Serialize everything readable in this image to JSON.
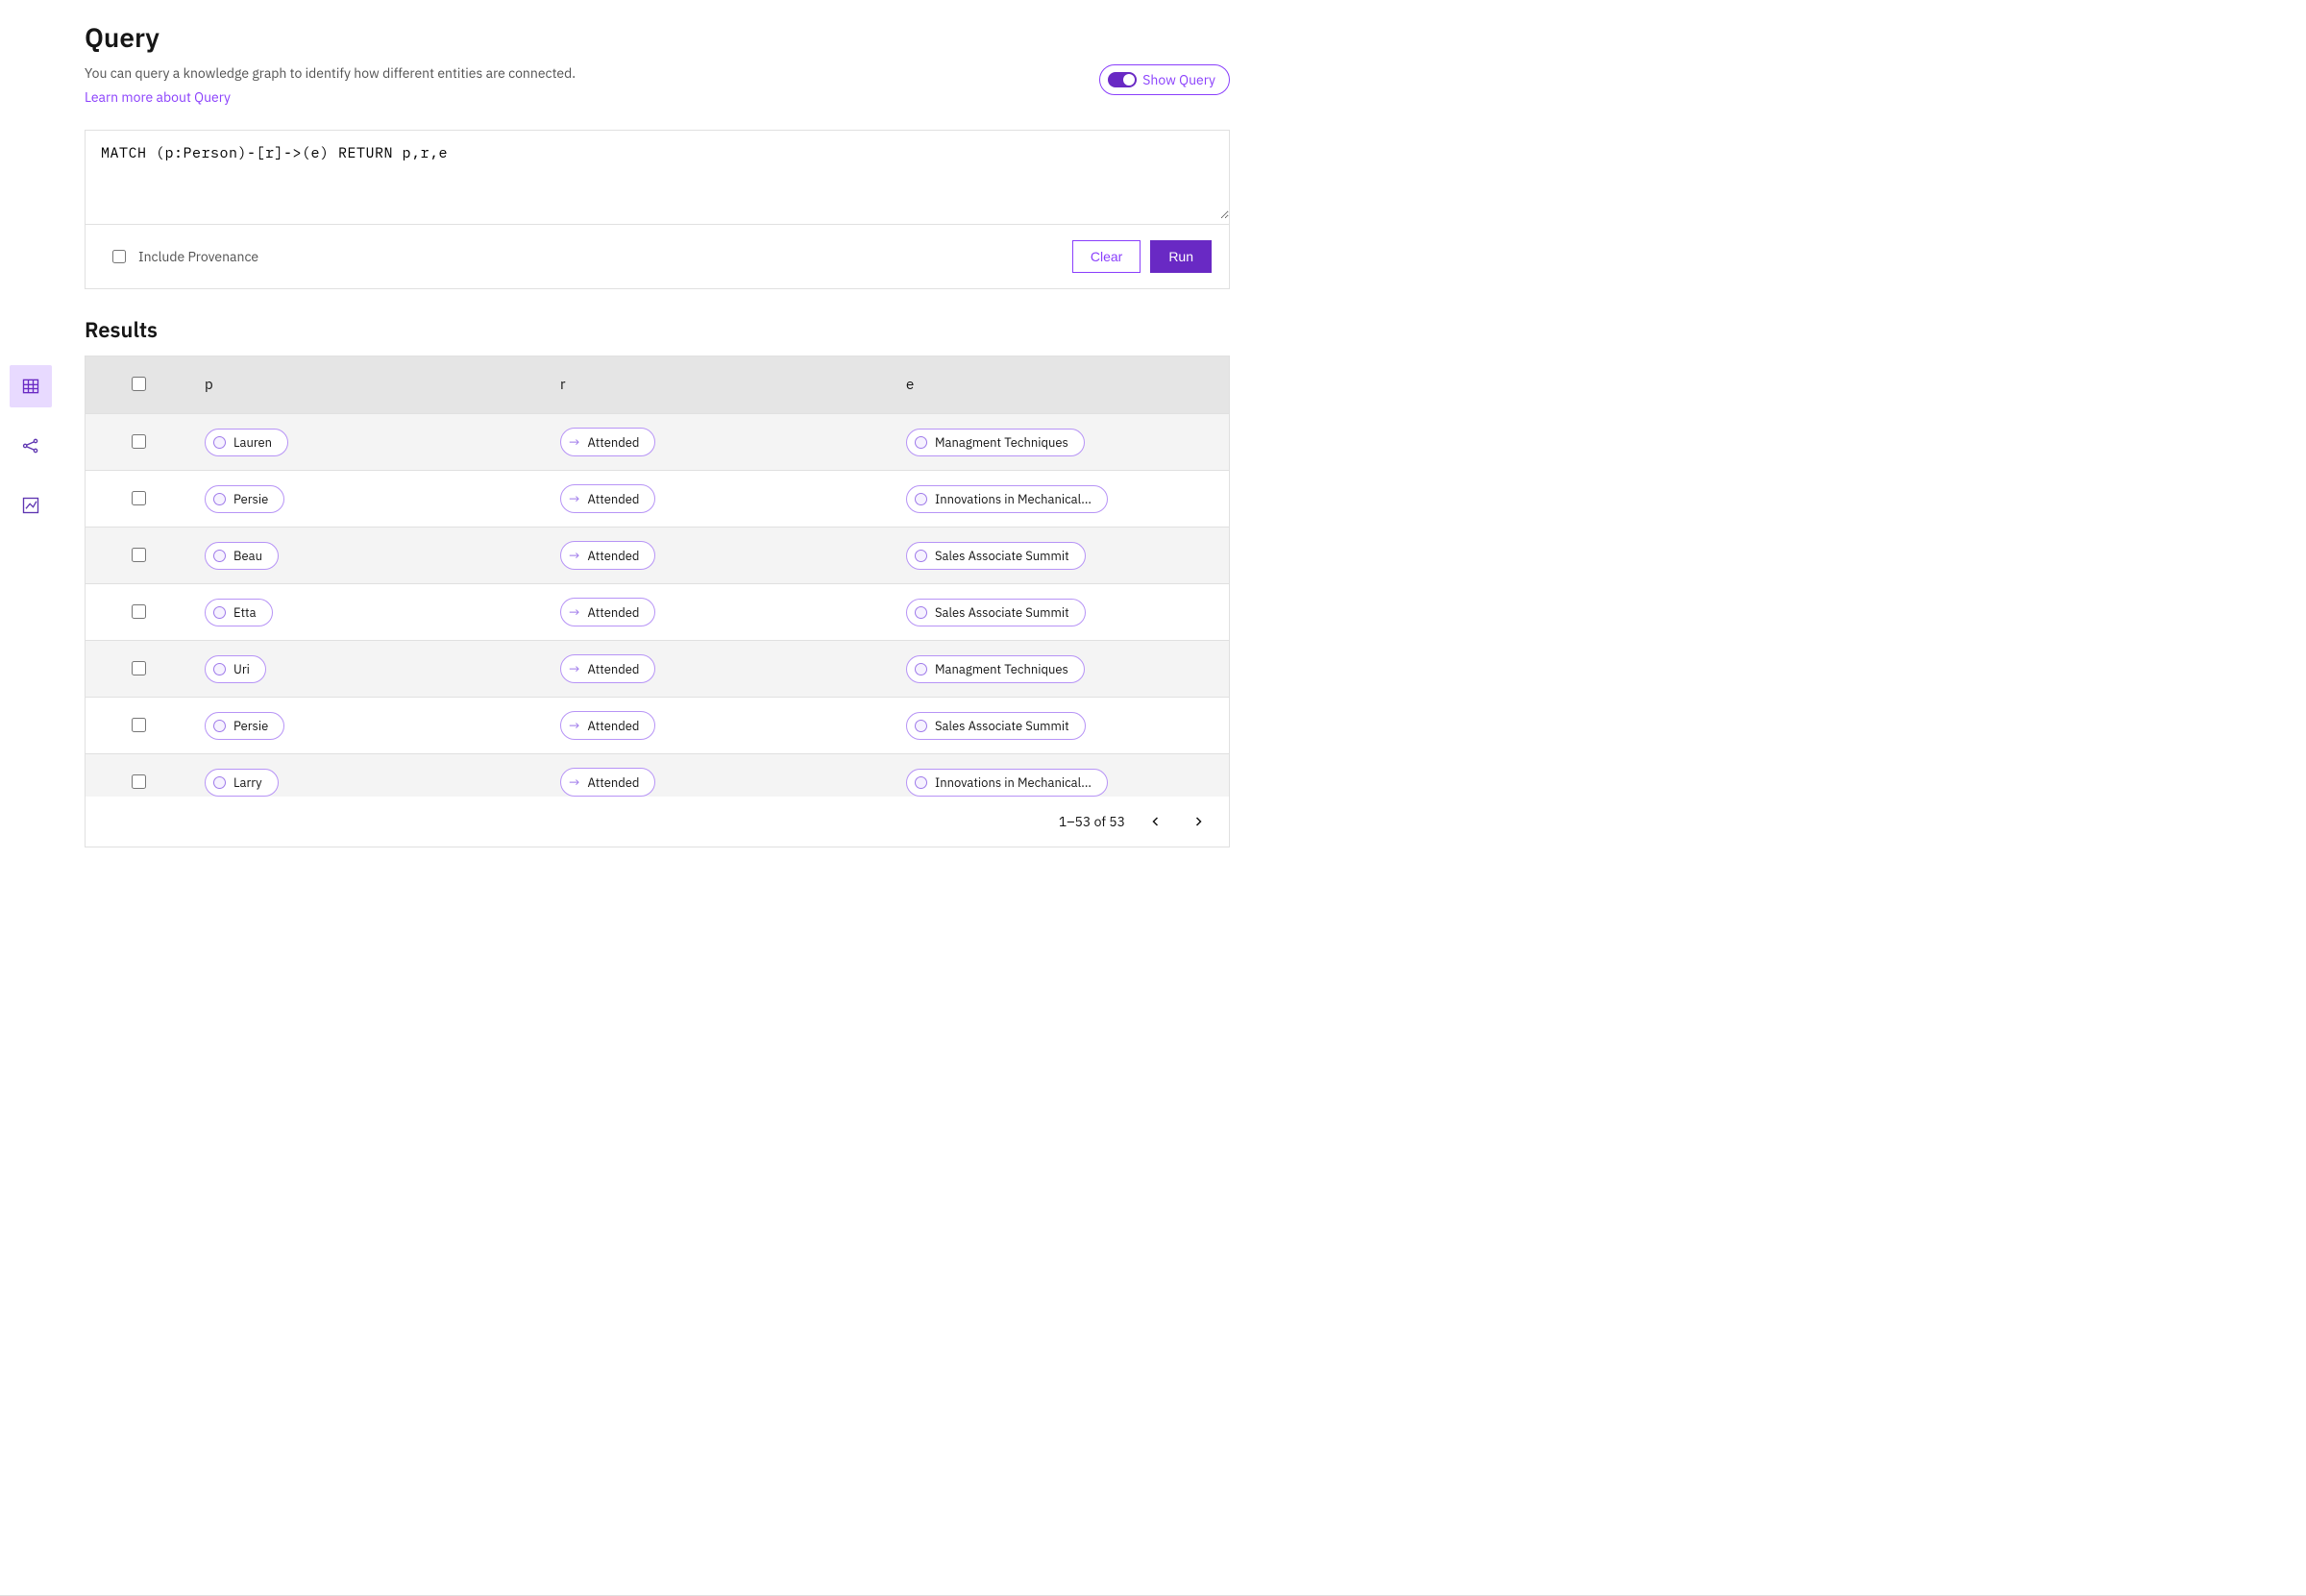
{
  "header": {
    "title": "Query",
    "description": "You can query a knowledge graph to identify how different entities are connected.",
    "learn_more": "Learn more about Query",
    "show_query_label": "Show Query"
  },
  "query": {
    "text": "MATCH (p:Person)-[r]->(e) RETURN p,r,e",
    "include_provenance_label": "Include Provenance",
    "clear_label": "Clear",
    "run_label": "Run"
  },
  "results": {
    "title": "Results",
    "columns": {
      "p": "p",
      "r": "r",
      "e": "e"
    },
    "rows": [
      {
        "p": "Lauren",
        "r": "Attended",
        "e": "Managment Techniques"
      },
      {
        "p": "Persie",
        "r": "Attended",
        "e": "Innovations in Mechanical..."
      },
      {
        "p": "Beau",
        "r": "Attended",
        "e": "Sales Associate Summit"
      },
      {
        "p": "Etta",
        "r": "Attended",
        "e": "Sales Associate Summit"
      },
      {
        "p": "Uri",
        "r": "Attended",
        "e": "Managment Techniques"
      },
      {
        "p": "Persie",
        "r": "Attended",
        "e": "Sales Associate Summit"
      },
      {
        "p": "Larry",
        "r": "Attended",
        "e": "Innovations in Mechanical..."
      }
    ],
    "pager": "1–53 of 53"
  },
  "rail": {
    "table": "table-view",
    "graph": "graph-view",
    "stats": "stats-view"
  }
}
